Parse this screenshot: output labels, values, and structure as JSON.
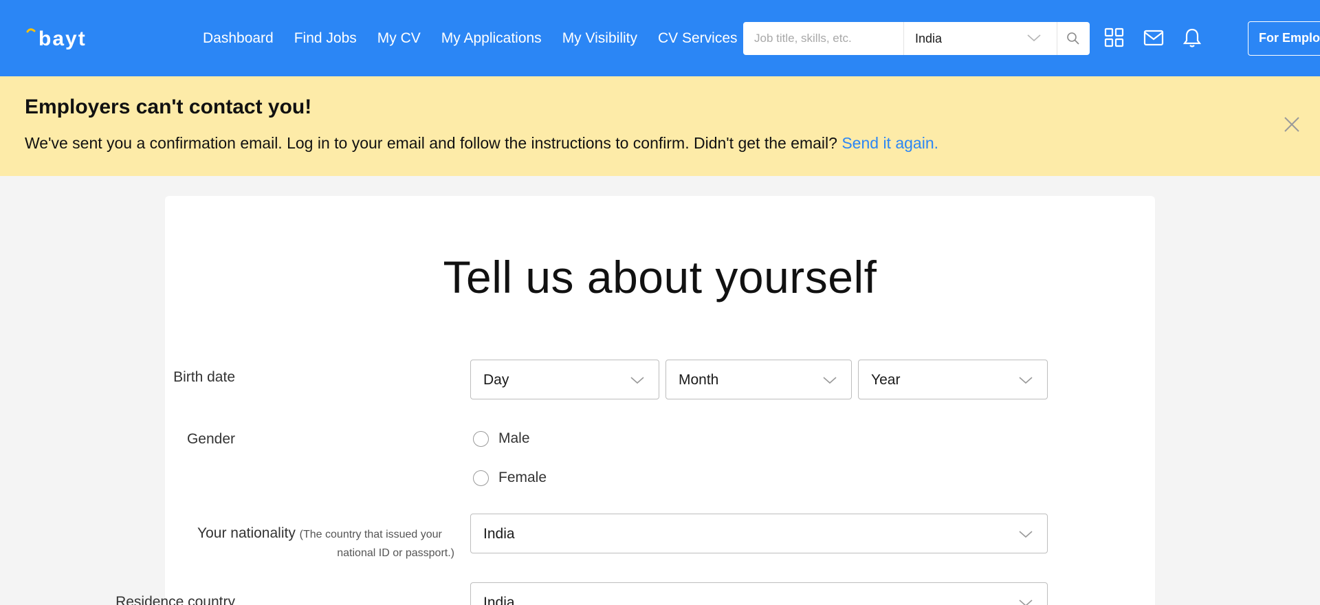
{
  "header": {
    "logo_text": "bayt",
    "nav": [
      "Dashboard",
      "Find Jobs",
      "My CV",
      "My Applications",
      "My Visibility",
      "CV Services"
    ],
    "search": {
      "placeholder": "Job title, skills, etc.",
      "location": "India"
    },
    "icons": [
      "grid-icon",
      "mail-icon",
      "bell-icon"
    ],
    "employers_button": "For Employers"
  },
  "banner": {
    "title": "Employers can't contact you!",
    "message": "We've sent you a confirmation email. Log in to your email and follow the instructions to confirm. Didn't get the email?",
    "link": "Send it again."
  },
  "form": {
    "title": "Tell us about yourself",
    "birth_date": {
      "label": "Birth date",
      "day": "Day",
      "month": "Month",
      "year": "Year"
    },
    "gender": {
      "label": "Gender",
      "options": [
        "Male",
        "Female"
      ]
    },
    "nationality": {
      "label": "Your nationality",
      "hint": "(The country that issued your national ID or passport.)",
      "hint_line1": "(The country that issued your",
      "hint_line2": "national ID or passport.)",
      "value": "India"
    },
    "residence": {
      "label": "Residence country",
      "value": "India"
    }
  },
  "colors": {
    "brand_blue": "#2b86f5",
    "banner_yellow": "#fdeba8",
    "page_bg": "#f4f4f4"
  }
}
